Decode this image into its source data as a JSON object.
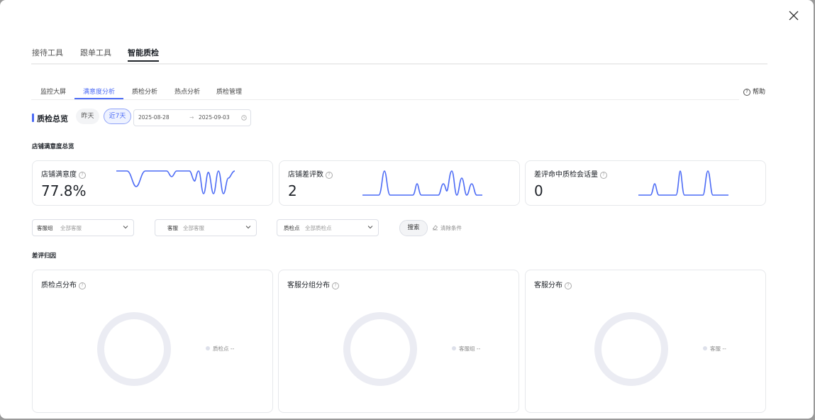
{
  "main_tabs": [
    "接待工具",
    "跟单工具",
    "智能质检"
  ],
  "sub_tabs": [
    "监控大屏",
    "满意度分析",
    "质检分析",
    "热点分析",
    "质检管理"
  ],
  "help_label": "帮助",
  "overview": {
    "title": "质检总览",
    "yesterday_label": "昨天",
    "last7_label": "近7天",
    "date_start": "2025-08-28",
    "date_sep": "→",
    "date_end": "2025-09-03"
  },
  "store_section_title": "店铺满意度总览",
  "stat_cards": [
    {
      "label": "店铺满意度",
      "value": "77.8%"
    },
    {
      "label": "店铺差评数",
      "value": "2"
    },
    {
      "label": "差评命中质检会话量",
      "value": "0"
    }
  ],
  "filters": {
    "group_label": "客服组",
    "group_placeholder": "全部客服",
    "agent_label": "客服",
    "agent_placeholder": "全部客服",
    "point_label": "质检点",
    "point_placeholder": "全部质检点",
    "search_label": "搜索",
    "clear_label": "清除条件"
  },
  "attribution_title": "差评归因",
  "dist_cards": [
    {
      "title": "质检点分布",
      "legend": "质检点",
      "legend_value": "--"
    },
    {
      "title": "客服分组分布",
      "legend": "客服组",
      "legend_value": "--"
    },
    {
      "title": "客服分布",
      "legend": "客服",
      "legend_value": "--"
    }
  ],
  "colors": {
    "accent": "#4c6bf5",
    "donut_track": "#ebecf3"
  },
  "icons": {
    "close": "close-icon",
    "help": "help-icon",
    "info": "info-icon",
    "calendar": "calendar-icon",
    "chevron": "chevron-down-icon",
    "eraser": "eraser-icon"
  }
}
